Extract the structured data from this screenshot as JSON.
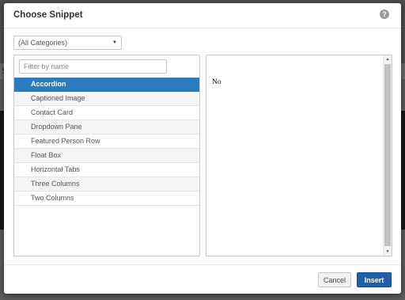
{
  "dialog": {
    "title": "Choose Snippet",
    "help_icon": "question-circle-icon",
    "help_glyph": "?"
  },
  "category": {
    "selected": "(All Categories)"
  },
  "filter": {
    "placeholder": "Filter by name",
    "value": ""
  },
  "snippets": {
    "selected_index": 0,
    "items": [
      {
        "label": "Accordion"
      },
      {
        "label": "Captioned Image"
      },
      {
        "label": "Contact Card"
      },
      {
        "label": "Dropdown Pane"
      },
      {
        "label": "Featured Person Row"
      },
      {
        "label": "Float Box"
      },
      {
        "label": "Horizontal Tabs"
      },
      {
        "label": "Three Columns"
      },
      {
        "label": "Two Columns"
      }
    ]
  },
  "preview": {
    "text": "No"
  },
  "footer": {
    "cancel_label": "Cancel",
    "insert_label": "Insert"
  },
  "background": {
    "letter": "S"
  },
  "colors": {
    "accent": "#2a7bbf",
    "primary_button": "#1f5fa8"
  }
}
